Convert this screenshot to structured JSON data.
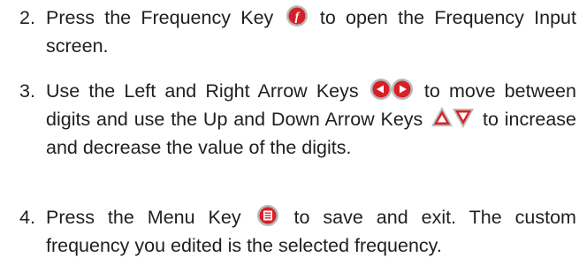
{
  "steps": [
    {
      "number": "2.",
      "text_before": "Press the Frequency Key",
      "icon": "frequency-key-icon",
      "text_after": "to open the Frequency Input screen."
    },
    {
      "number": "3.",
      "text_before": "Use the Left and Right Arrow Keys",
      "icon_a": "left-arrow-key-icon",
      "icon_b": "right-arrow-key-icon",
      "text_middle": "to move between digits and use the Up and Down Arrow Keys",
      "icon_c": "up-arrow-key-icon",
      "icon_d": "down-arrow-key-icon",
      "text_after": "to increase and decrease the value of the digits."
    },
    {
      "number": "4.",
      "text_before": "Press the Menu Key",
      "icon": "menu-key-icon",
      "text_after": "to save and exit. The custom frequency you edited is the selected frequency."
    }
  ],
  "colors": {
    "key_red": "#d62027",
    "text": "#1f1f1f"
  }
}
